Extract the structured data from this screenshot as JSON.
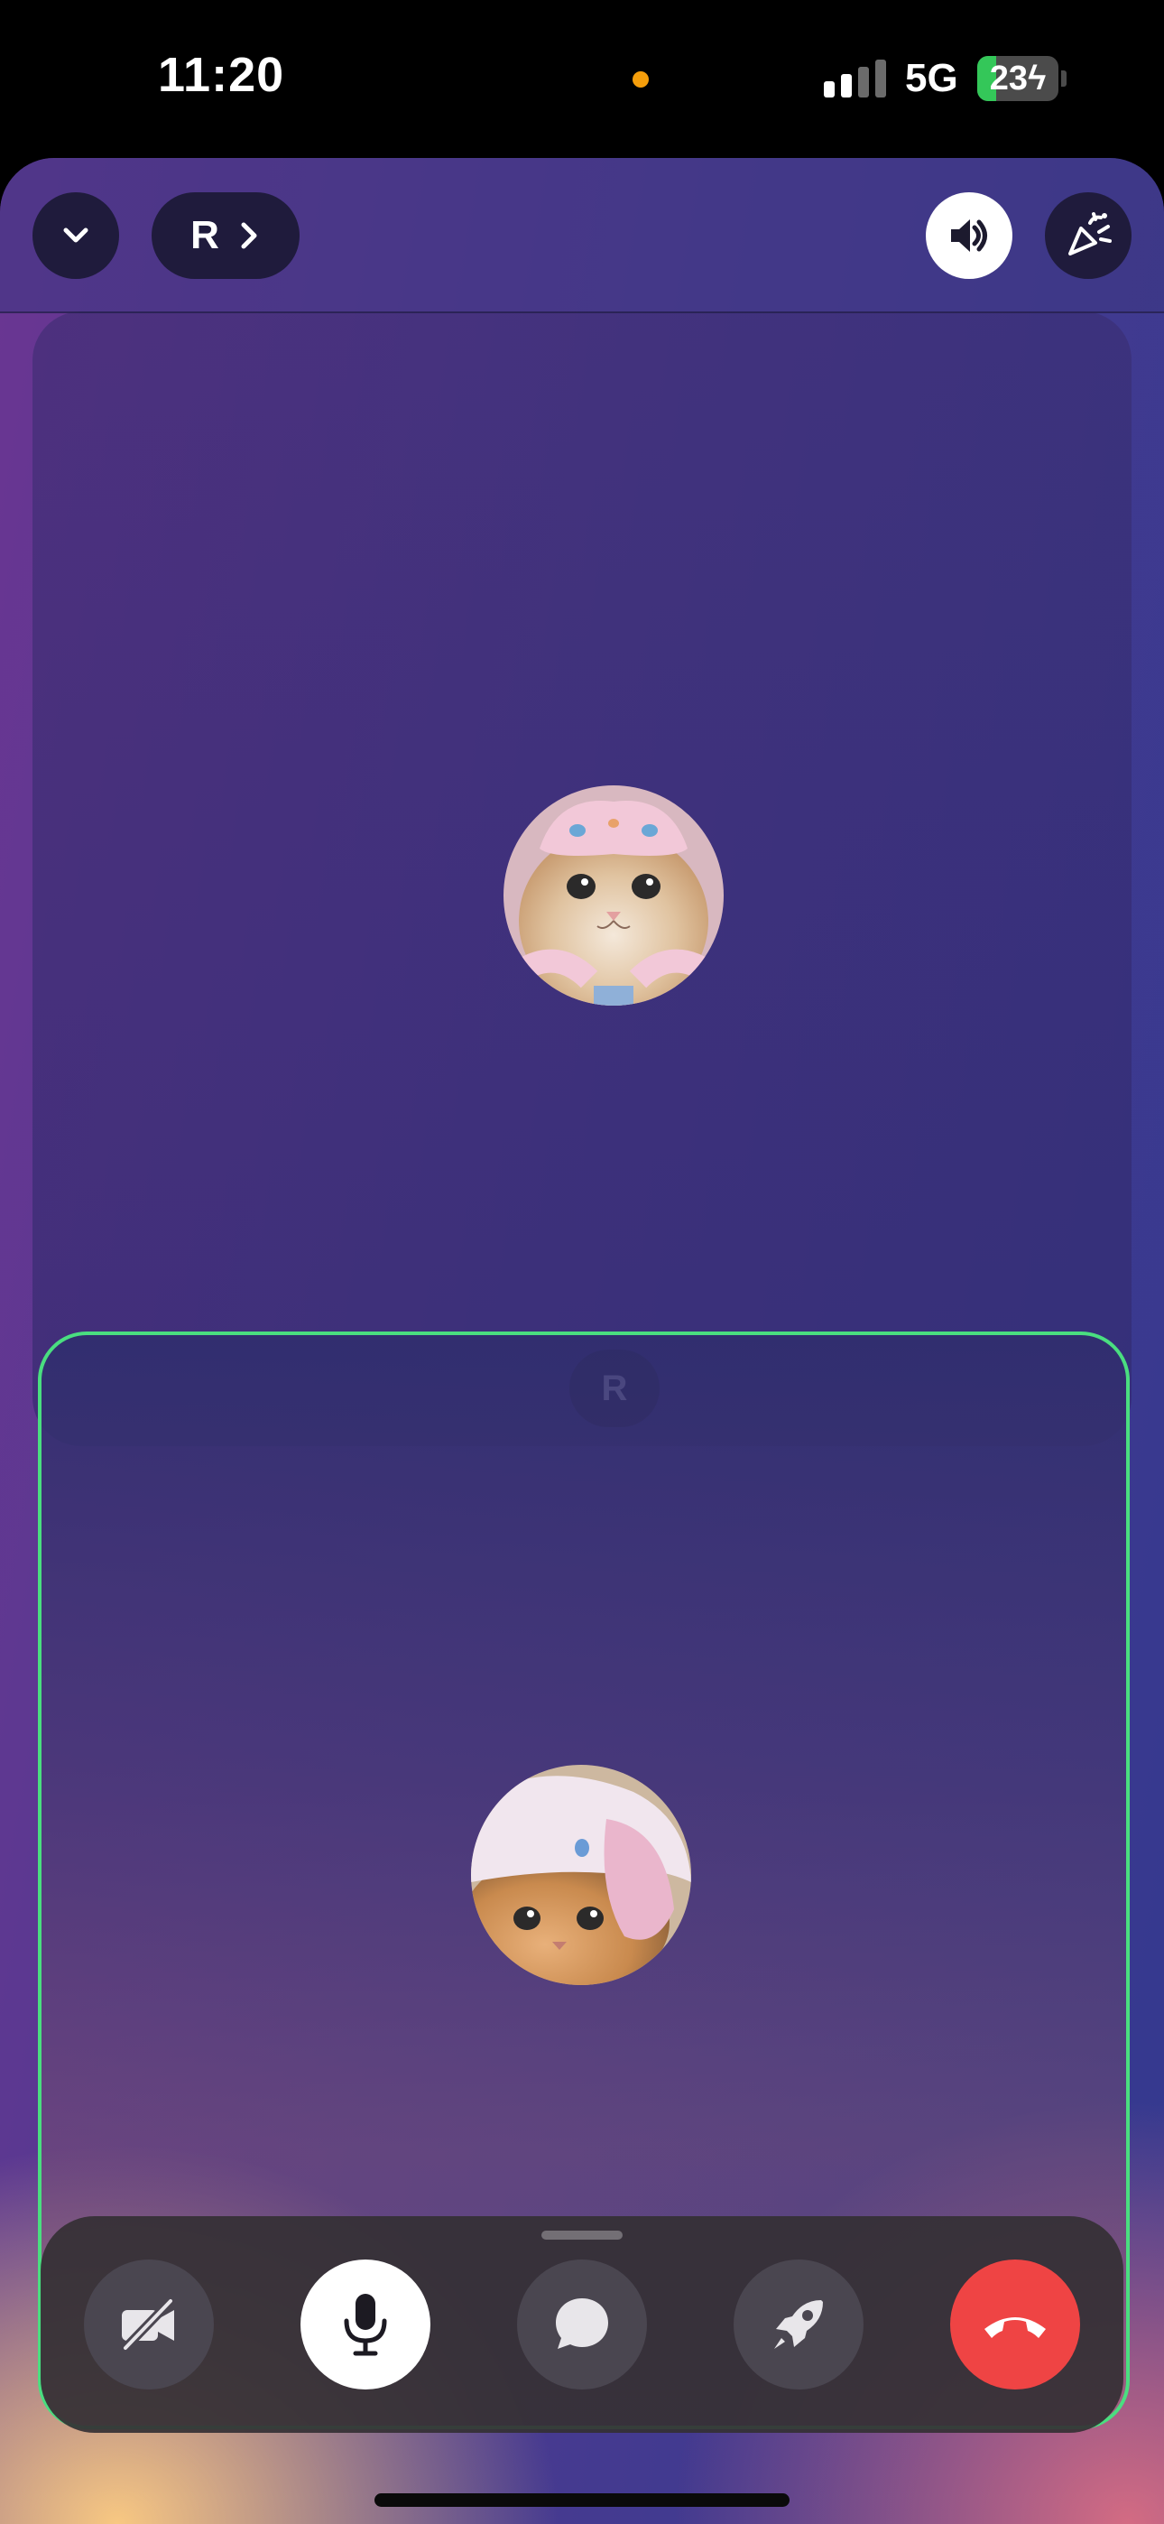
{
  "status_bar": {
    "time": "11:20",
    "network": "5G",
    "battery_level": "23",
    "battery_fraction": 0.23,
    "charging": true,
    "signal_bars_active": 2,
    "signal_bars_total": 4,
    "privacy_indicator_color": "#f59e0b"
  },
  "header": {
    "collapse_icon": "chevron-down-icon",
    "participant_initial": "R",
    "participant_chevron_icon": "chevron-right-icon",
    "speaker_icon": "speaker-icon",
    "effects_icon": "effects-icon"
  },
  "remote_tile": {
    "avatar": "cat-avatar-pink-hat",
    "name_chip": "R"
  },
  "local_tile": {
    "avatar": "cat-avatar-bunny-hat",
    "speaking_border_color": "#4ade80"
  },
  "controls": {
    "camera_icon": "camera-off-icon",
    "mic_icon": "microphone-icon",
    "chat_icon": "chat-icon",
    "boost_icon": "rocket-icon",
    "end_call_icon": "end-call-icon",
    "end_call_color": "#ef4444"
  }
}
